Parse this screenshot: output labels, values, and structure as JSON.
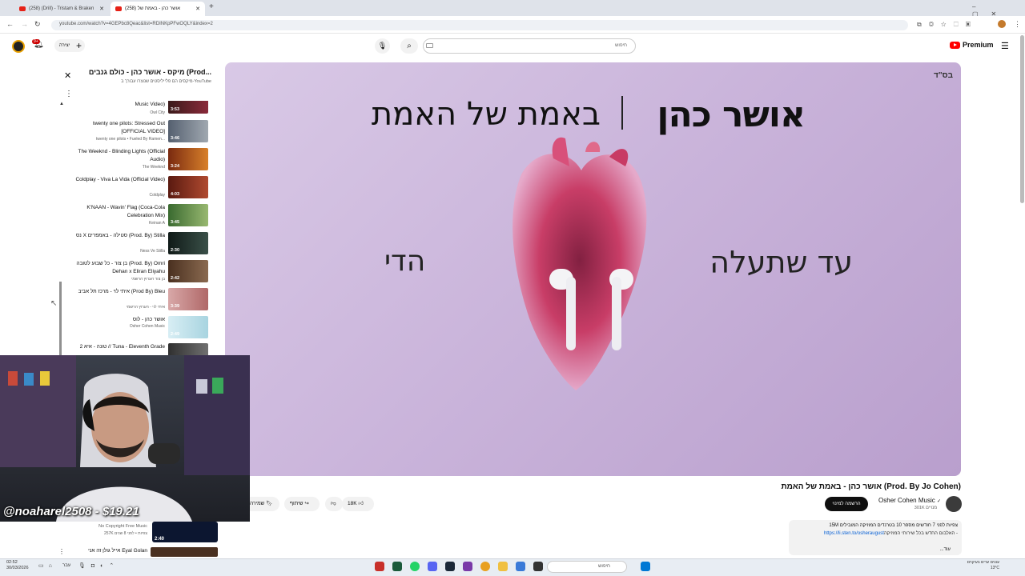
{
  "browser": {
    "tabs": [
      {
        "label": "(258) (Drill) - Tristam & Braken",
        "active": false
      },
      {
        "label": "(258) אושר כהן - באמת של",
        "active": true
      }
    ],
    "new_tab": "+",
    "url": "youtube.com/watch?v=4GEPbc8Qeac&list=RDINKpPFwOQLY&index=2"
  },
  "header": {
    "logo_text": "Premium",
    "search_placeholder": "חיפוש",
    "create_label": "יצירה",
    "notif_badge": "9+"
  },
  "playlist": {
    "title": "מיקס - אושר כהן - כולם גנבים (Prod...",
    "subtitle": "מיקסים הם פלייליסטים שנוצרו עבורך ב-YouTube",
    "items": [
      {
        "title": "Music Video)",
        "channel": "Owl City",
        "duration": "3:53"
      },
      {
        "title": "twenty one pilots: Stressed Out [OFFICIAL VIDEO]",
        "channel": "twenty one pilots • Fueled By Ramen...",
        "duration": "3:46"
      },
      {
        "title": "The Weeknd - Blinding Lights (Official Audio)",
        "channel": "The Weeknd",
        "duration": "3:24"
      },
      {
        "title": "Coldplay - Viva La Vida (Official Video)",
        "channel": "Coldplay",
        "duration": "4:03"
      },
      {
        "title": "K'NAAN - Wavin' Flag (Coca-Cola Celebration Mix)",
        "channel": "Keinan A",
        "duration": "3:45"
      },
      {
        "title": "נס X סטילה - באמפרים (Prod. By) Stilla",
        "channel": "Ness Ve Stilla",
        "duration": "2:30"
      },
      {
        "title": "בן צור - כל שבוע לטובה (Prod. By) Omri Dehan x Eliran Eliyahu",
        "channel": "בן צור הערוץ הרשמי",
        "duration": "2:42"
      },
      {
        "title": "איתי לוי - מרכז תל אביב (Prod By) Bleu",
        "channel": "איתי לוי - הערוץ הרשמי",
        "duration": "3:39"
      },
      {
        "title": "אושר כהן - לוס",
        "channel": "Osher Cohen Music",
        "duration": "2:49"
      },
      {
        "title": "טונה - איא 2 // Tuna - Eleventh Grade",
        "channel": "",
        "duration": ""
      }
    ]
  },
  "player": {
    "cover_label": "בס\"ד",
    "cover_artist": "אושר כהן",
    "cover_song": "באמת של האמת",
    "cover_left": "הדי",
    "cover_right": "עד שתעלה"
  },
  "video": {
    "title": "אושר כהן - באמת של האמת (Prod. By Jo Cohen)",
    "channel": "Osher Cohen Music",
    "verified": "✓",
    "subscribers": "301K מנויים",
    "subscribe_label": "הרשמה למינוי",
    "likes": "18K",
    "share_label": "שיתוף",
    "save_label": "שמירה",
    "desc_stats": "15M צפיות  לפני 7 חודשים  מספר 10 בטרנדים המוזיקה המובילים",
    "desc_line": "האלבום החדש בכל שירותי המוזיקה -",
    "desc_link": "https://li.sten.to/osheraugust",
    "desc_more": "...עוד"
  },
  "webcam": {
    "caption": "@noaharel2508 - $19.21"
  },
  "below_cam": {
    "line1": "No Copyright Free Music",
    "line2": "257K צפיות • לפני 8 שנים",
    "duration": "2:40",
    "title2": "אייל גולן זה אני Eyal Golan"
  },
  "taskbar": {
    "time": "02:52",
    "date": "30/03/2026",
    "search": "חיפוש",
    "lang": "עבר",
    "weather1": "עננים ערים בעיקרם",
    "weather2": "13°C"
  },
  "colors": {
    "accent": "#ff0000",
    "cover_bg": "#c9b3da"
  }
}
